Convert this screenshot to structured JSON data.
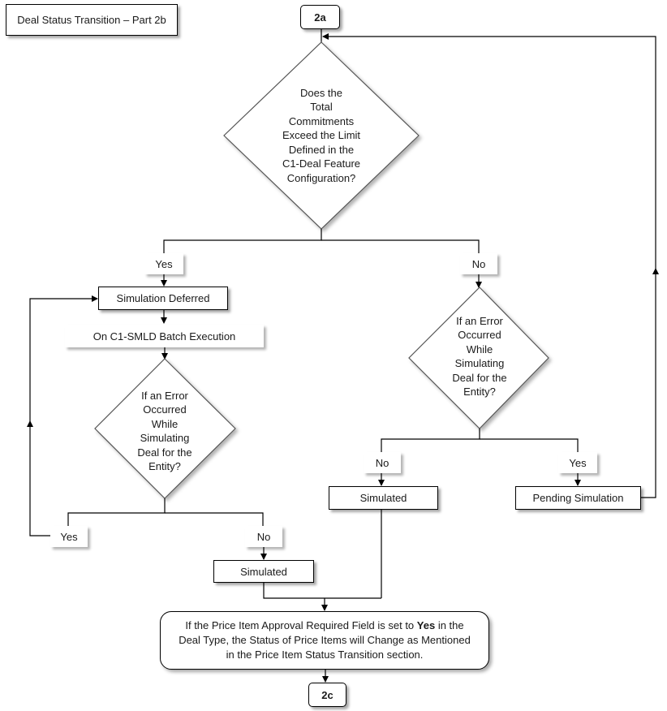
{
  "diagram": {
    "title": "Deal Status Transition – Part 2b",
    "connectors": {
      "start": "2a",
      "end": "2c"
    },
    "decisions": {
      "total_commitments": "Does the Total Commitments Exceed the Limit Defined in the C1-Deal Feature Configuration?",
      "error_left": "If an Error Occurred While Simulating Deal for the Entity?",
      "error_right": "If an Error Occurred While Simulating Deal for the Entity?"
    },
    "decision_lines": {
      "total_commitments": [
        "Does the",
        "Total",
        "Commitments",
        "Exceed the Limit",
        "Defined in the",
        "C1-Deal Feature",
        "Configuration?"
      ],
      "error_left": [
        "If an Error",
        "Occurred",
        "While",
        "Simulating",
        "Deal for the",
        "Entity?"
      ],
      "error_right": [
        "If an Error",
        "Occurred",
        "While",
        "Simulating",
        "Deal for the",
        "Entity?"
      ]
    },
    "branch_labels": {
      "main_yes": "Yes",
      "main_no": "No",
      "left_yes": "Yes",
      "left_no": "No",
      "right_no": "No",
      "right_yes": "Yes"
    },
    "states": {
      "simulation_deferred": "Simulation Deferred",
      "simulated_left": "Simulated",
      "simulated_right": "Simulated",
      "pending_simulation": "Pending Simulation"
    },
    "events": {
      "batch_execution": "On C1-SMLD Batch Execution"
    },
    "note": {
      "before_bold": "If the Price Item Approval Required Field is set to ",
      "bold": "Yes",
      "after_bold": " in the Deal Type, the Status of Price Items will Change as Mentioned in the Price Item Status Transition section."
    }
  }
}
